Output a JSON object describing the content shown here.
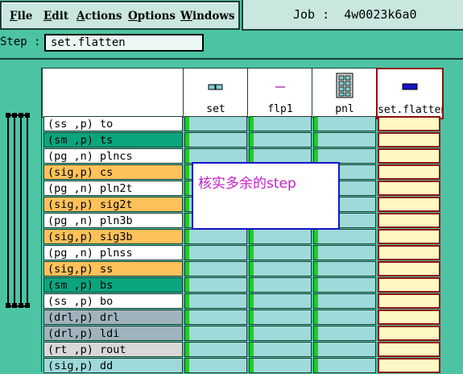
{
  "menu": [
    "File",
    "Edit",
    "Actions",
    "Options",
    "Windows"
  ],
  "job": {
    "label": "Job :",
    "value": "4w0023k6a0"
  },
  "step": {
    "label": "Step :",
    "value": "set.flatten"
  },
  "columns": [
    {
      "label": "set",
      "icon": "set-icon"
    },
    {
      "label": "flp1",
      "icon": "flp1-icon"
    },
    {
      "label": "pnl",
      "icon": "pnl-icon"
    },
    {
      "label": "set.flatten",
      "icon": "set-flatten-icon",
      "selected": true
    }
  ],
  "layers": [
    {
      "name": "(ss ,p) to",
      "color": "#ffffff"
    },
    {
      "name": "(sm ,p) ts",
      "color": "#0aa57f"
    },
    {
      "name": "(pg ,n) plncs",
      "color": "#ffffff"
    },
    {
      "name": "(sig,p) cs",
      "color": "#ffc15a"
    },
    {
      "name": "(pg ,n) pln2t",
      "color": "#ffffff"
    },
    {
      "name": "(sig,p) sig2t",
      "color": "#ffc15a"
    },
    {
      "name": "(pg ,n) pln3b",
      "color": "#ffffff"
    },
    {
      "name": "(sig,p) sig3b",
      "color": "#ffc15a"
    },
    {
      "name": "(pg ,n) plnss",
      "color": "#ffffff"
    },
    {
      "name": "(sig,p) ss",
      "color": "#ffc15a"
    },
    {
      "name": "(sm ,p) bs",
      "color": "#0aa57f"
    },
    {
      "name": "(ss ,p) bo",
      "color": "#ffffff"
    },
    {
      "name": "(drl,p) drl",
      "color": "#9fb3bd"
    },
    {
      "name": "(drl,p) ldi",
      "color": "#9fb3bd"
    },
    {
      "name": "(rt ,p) rout",
      "color": "#d8d8d8"
    },
    {
      "name": "(sig,p) dd",
      "color": "#9fd9d9"
    }
  ],
  "note": "核实多余的step"
}
